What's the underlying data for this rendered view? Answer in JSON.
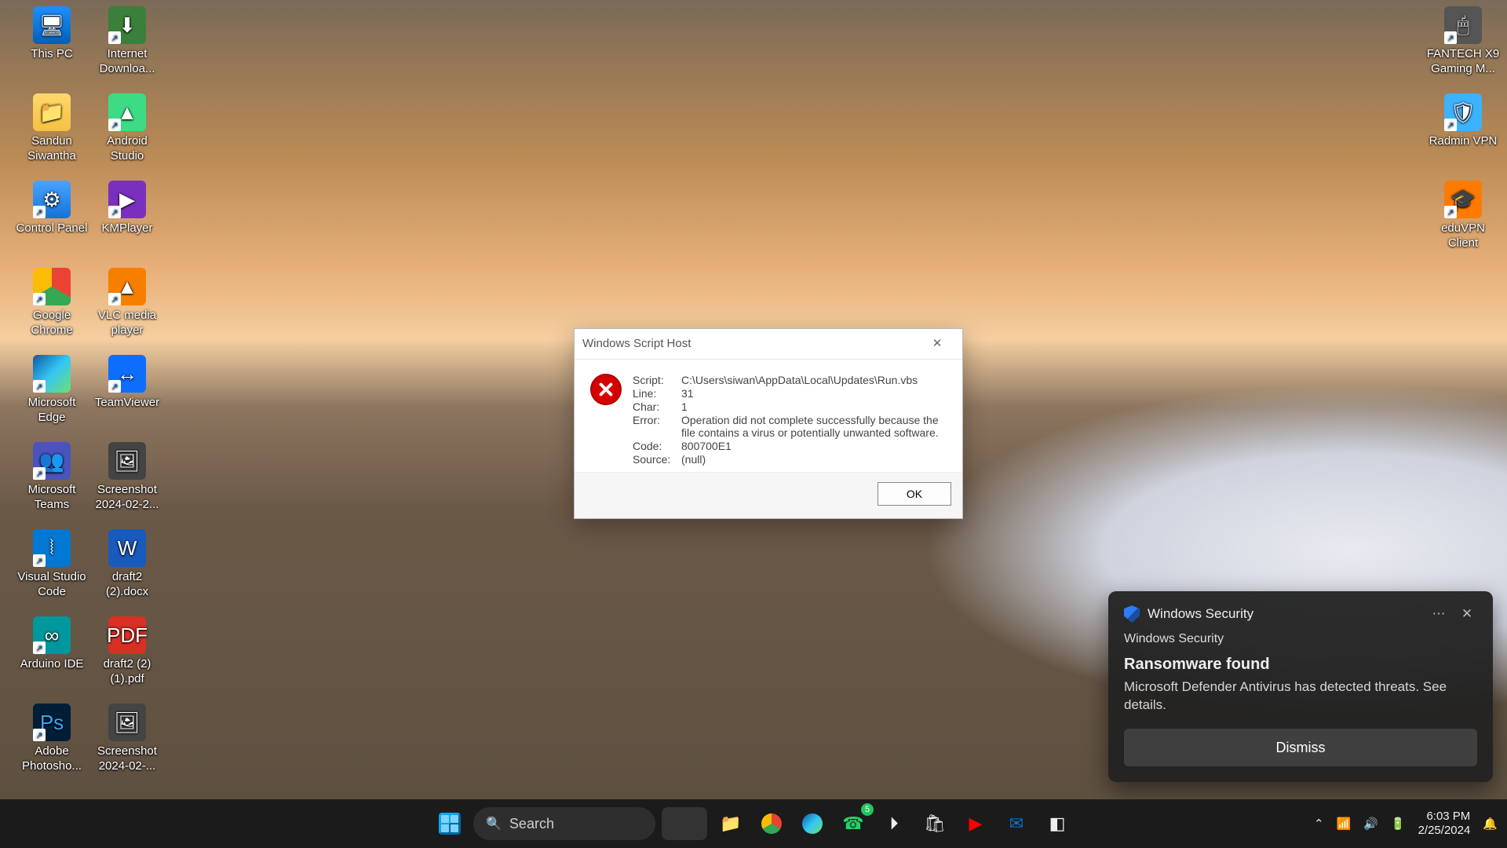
{
  "desktop_icons_left": [
    {
      "label": "This PC",
      "cls": "bg-monitor",
      "glyph": "🖥"
    },
    {
      "label": "Internet Downloa...",
      "cls": "bg-idm shortcut",
      "glyph": "⬇"
    },
    {
      "label": "Sandun Siwantha",
      "cls": "bg-folder",
      "glyph": "📁"
    },
    {
      "label": "Android Studio",
      "cls": "bg-as shortcut",
      "glyph": "▲"
    },
    {
      "label": "Control Panel",
      "cls": "bg-ctrl shortcut",
      "glyph": "⚙"
    },
    {
      "label": "KMPlayer",
      "cls": "bg-km shortcut",
      "glyph": "▶"
    },
    {
      "label": "Google Chrome",
      "cls": "bg-chrome shortcut",
      "glyph": ""
    },
    {
      "label": "VLC media player",
      "cls": "bg-vlc shortcut",
      "glyph": "▲"
    },
    {
      "label": "Microsoft Edge",
      "cls": "bg-edge shortcut",
      "glyph": ""
    },
    {
      "label": "TeamViewer",
      "cls": "bg-tv shortcut",
      "glyph": "↔"
    },
    {
      "label": "Microsoft Teams",
      "cls": "bg-teams shortcut",
      "glyph": "👥"
    },
    {
      "label": "Screenshot 2024-02-2...",
      "cls": "bg-dark",
      "glyph": "🖼"
    },
    {
      "label": "Visual Studio Code",
      "cls": "bg-vscode shortcut",
      "glyph": "⦚"
    },
    {
      "label": "draft2 (2).docx",
      "cls": "bg-word",
      "glyph": "W"
    },
    {
      "label": "Arduino IDE",
      "cls": "bg-arduino shortcut",
      "glyph": "∞"
    },
    {
      "label": "draft2 (2) (1).pdf",
      "cls": "bg-pdf",
      "glyph": "PDF"
    },
    {
      "label": "Adobe Photosho...",
      "cls": "bg-ps shortcut",
      "glyph": "Ps"
    },
    {
      "label": "Screenshot 2024-02-...",
      "cls": "bg-dark",
      "glyph": "🖼"
    }
  ],
  "desktop_icons_right": [
    {
      "label": "FANTECH X9 Gaming M...",
      "cls": "bg-fan shortcut",
      "glyph": "🖱"
    },
    {
      "label": "Radmin VPN",
      "cls": "bg-radmin shortcut",
      "glyph": "🛡"
    },
    {
      "label": "eduVPN Client",
      "cls": "bg-edu shortcut",
      "glyph": "🎓"
    }
  ],
  "dialog": {
    "title": "Windows Script Host",
    "rows": [
      {
        "k": "Script:",
        "v": "C:\\Users\\siwan\\AppData\\Local\\Updates\\Run.vbs"
      },
      {
        "k": "Line:",
        "v": "31"
      },
      {
        "k": "Char:",
        "v": "1"
      },
      {
        "k": "Error:",
        "v": "Operation did not complete successfully because the file contains a virus or potentially unwanted software."
      },
      {
        "k": "Code:",
        "v": "800700E1"
      },
      {
        "k": "Source:",
        "v": "(null)"
      }
    ],
    "ok": "OK"
  },
  "toast": {
    "app": "Windows Security",
    "header": "Windows Security",
    "title": "Ransomware found",
    "body": "Microsoft Defender Antivirus has detected threats. See details.",
    "dismiss": "Dismiss"
  },
  "taskbar": {
    "search_placeholder": "Search",
    "whatsapp_badge": "5",
    "time": "6:03 PM",
    "date": "2/25/2024"
  }
}
